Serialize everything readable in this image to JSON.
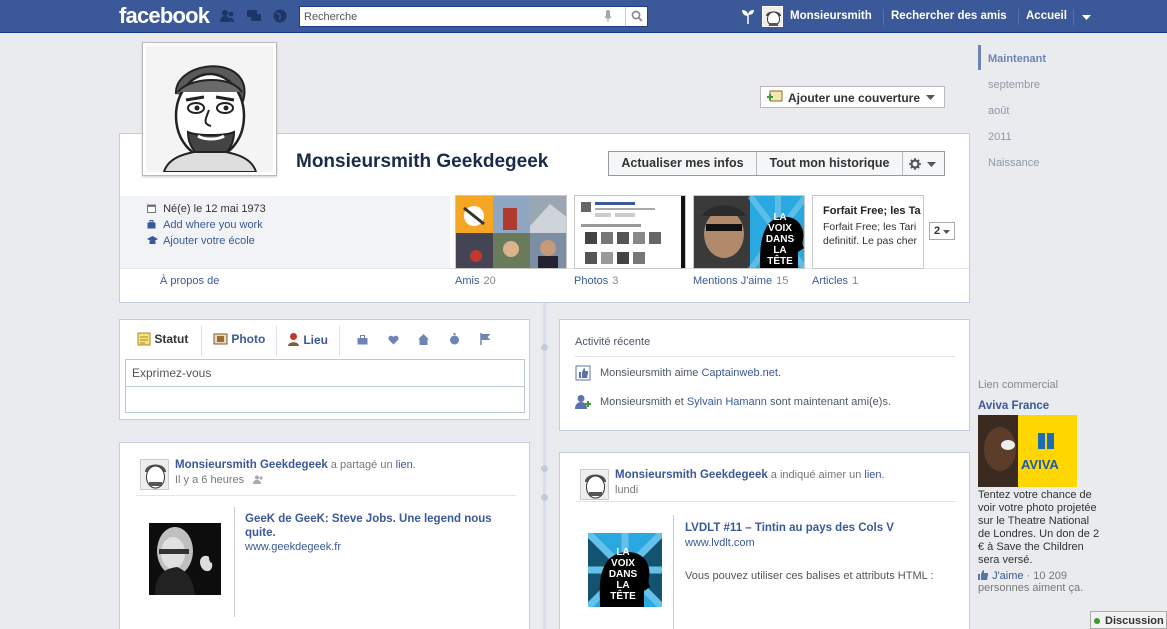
{
  "topbar": {
    "logo": "facebook",
    "search_placeholder": "Recherche",
    "user_name": "Monsieursmith",
    "find_friends": "Rechercher des amis",
    "home": "Accueil"
  },
  "profile": {
    "name": "Monsieursmith Geekdegeek",
    "add_cover": "Ajouter une couverture",
    "update_info": "Actualiser mes infos",
    "activity_log": "Tout mon historique"
  },
  "about": {
    "birthday": "Né(e) le 12 mai 1973",
    "add_work": "Add where you work",
    "add_school": "Ajouter votre école",
    "about_link": "À propos de"
  },
  "thumbs": [
    {
      "label": "Amis",
      "count": "20"
    },
    {
      "label": "Photos",
      "count": "3"
    },
    {
      "label": "Mentions J'aime",
      "count": "15"
    },
    {
      "label": "Articles",
      "count": "1"
    }
  ],
  "article_preview": {
    "title": "Forfait Free; les Ta definitif.",
    "body": "Forfait Free; les Tari definitif. Le pas cher"
  },
  "more_button": "2",
  "composer": {
    "tab_status": "Statut",
    "tab_photo": "Photo",
    "tab_place": "Lieu",
    "placeholder": "Exprimez-vous"
  },
  "activity": {
    "title": "Activité récente",
    "line1_prefix": "Monsieursmith aime ",
    "line1_link": "Captainweb.net",
    "line1_suffix": ".",
    "line2_prefix": "Monsieursmith et ",
    "line2_link": "Sylvain Hamann",
    "line2_suffix": " sont maintenant ami(e)s."
  },
  "post1": {
    "author": "Monsieursmith Geekdegeek",
    "action": " a partagé un ",
    "action_link": "lien",
    "action_end": ".",
    "time": "Il y a 6 heures",
    "link_title": "GeeK de GeeK: Steve Jobs. Une legend nous quite.",
    "link_url": "www.geekdegeek.fr"
  },
  "post2": {
    "author": "Monsieursmith Geekdegeek",
    "action": " a indiqué aimer un ",
    "action_link": "lien",
    "action_end": ".",
    "time": "lundi",
    "link_title": "LVDLT #11 – Tintin au pays des Cols V",
    "link_url": "www.lvdlt.com",
    "snippet": "Vous pouvez utiliser ces balises et attributs HTML :"
  },
  "scrubber": [
    "Maintenant",
    "septembre",
    "août",
    "2011",
    "Naissance"
  ],
  "ad": {
    "header": "Lien commercial",
    "title": "Aviva France",
    "brand": "AVIVA",
    "body": "Tentez votre chance de voir votre photo projetée sur le Theatre National de Londres. Un don de 2 € à Save the Children sera versé.",
    "like": "J'aime",
    "like_count": " · 10 209",
    "like_suffix": "personnes aiment ça."
  },
  "chat": "Discussion",
  "colors": {
    "fb_blue": "#3b5998",
    "link": "#3b5998",
    "page_bg": "#e9ebee",
    "lvdlt_blue": "#2aa8e0",
    "aviva_yellow": "#ffd600"
  }
}
